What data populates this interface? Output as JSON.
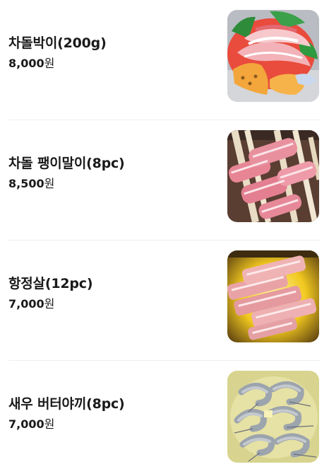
{
  "menu": {
    "items": [
      {
        "name": "차돌박이(200g)",
        "price": "8,000",
        "currency": "원",
        "image": "chadol-brisket-photo"
      },
      {
        "name": "차돌 팽이말이(8pc)",
        "price": "8,500",
        "currency": "원",
        "image": "brisket-enoki-roll-photo"
      },
      {
        "name": "항정살(12pc)",
        "price": "7,000",
        "currency": "원",
        "image": "pork-jowl-photo"
      },
      {
        "name": "새우 버터야끼(8pc)",
        "price": "7,000",
        "currency": "원",
        "image": "butter-shrimp-photo"
      }
    ]
  }
}
